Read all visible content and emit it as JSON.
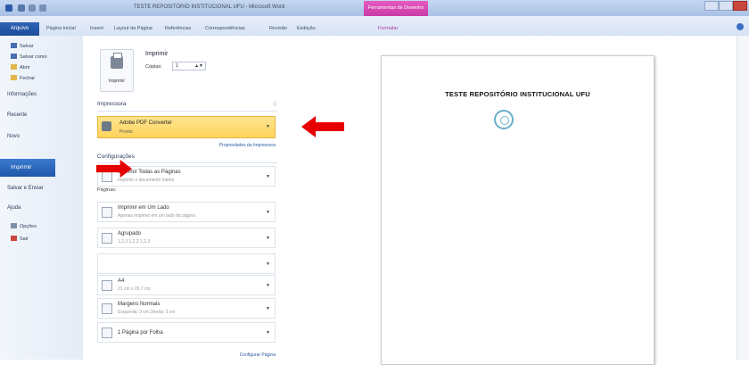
{
  "window": {
    "title": "TESTE REPOSITÓRIO INSTITUCIONAL UFU - Microsoft Word",
    "context_tab": "Ferramentas de Desenho"
  },
  "ribbon": {
    "file_tab": "Arquivo",
    "tabs": [
      "Página Inicial",
      "Inserir",
      "Layout da Página",
      "Referências",
      "Correspondências",
      "Revisão",
      "Exibição",
      "Formatar"
    ]
  },
  "nav": {
    "commands": [
      {
        "label": "Salvar",
        "icon": "save-icon"
      },
      {
        "label": "Salvar como",
        "icon": "save-as-icon"
      },
      {
        "label": "Abrir",
        "icon": "open-folder-icon"
      },
      {
        "label": "Fechar",
        "icon": "close-file-icon"
      }
    ],
    "tabs": [
      "Informações",
      "Recente",
      "Novo",
      "Imprimir",
      "Salvar e Enviar",
      "Ajuda"
    ],
    "bottom_commands": [
      {
        "label": "Opções",
        "icon": "options-icon"
      },
      {
        "label": "Sair",
        "icon": "exit-icon"
      }
    ]
  },
  "print": {
    "heading": "Imprimir",
    "button_label": "Imprimir",
    "copies_label": "Cópias:",
    "copies_value": "1",
    "printer_section": "Impressora",
    "printer_name": "Adobe PDF Converter",
    "printer_status": "Pronto",
    "printer_properties": "Propriedades da Impressora",
    "settings_section": "Configurações",
    "options": [
      {
        "line1": "Imprimir Todas as Páginas",
        "line2": "Imprimir o documento inteiro"
      },
      {
        "line1": "Imprimir em Um Lado",
        "line2": "Apenas imprimir em um lado da página"
      },
      {
        "line1": "Agrupado",
        "line2": "1,2,3   1,2,3   1,2,3"
      },
      {
        "line1": "",
        "line2": ""
      },
      {
        "line1": "A4",
        "line2": "21 cm x 29,7 cm"
      },
      {
        "line1": "Margens Normais",
        "line2": "Esquerda: 3 cm   Direita: 3 cm"
      },
      {
        "line1": "1 Página por Folha",
        "line2": ""
      }
    ],
    "pages_label": "Páginas:",
    "page_setup": "Configurar Página"
  },
  "preview": {
    "document_title": "TESTE REPOSITÓRIO INSTITUCIONAL UFU"
  },
  "colors": {
    "accent": "#1f56a8",
    "highlight": "#ffd45c",
    "arrow": "#e60000",
    "context_tab": "#c83aa6"
  }
}
